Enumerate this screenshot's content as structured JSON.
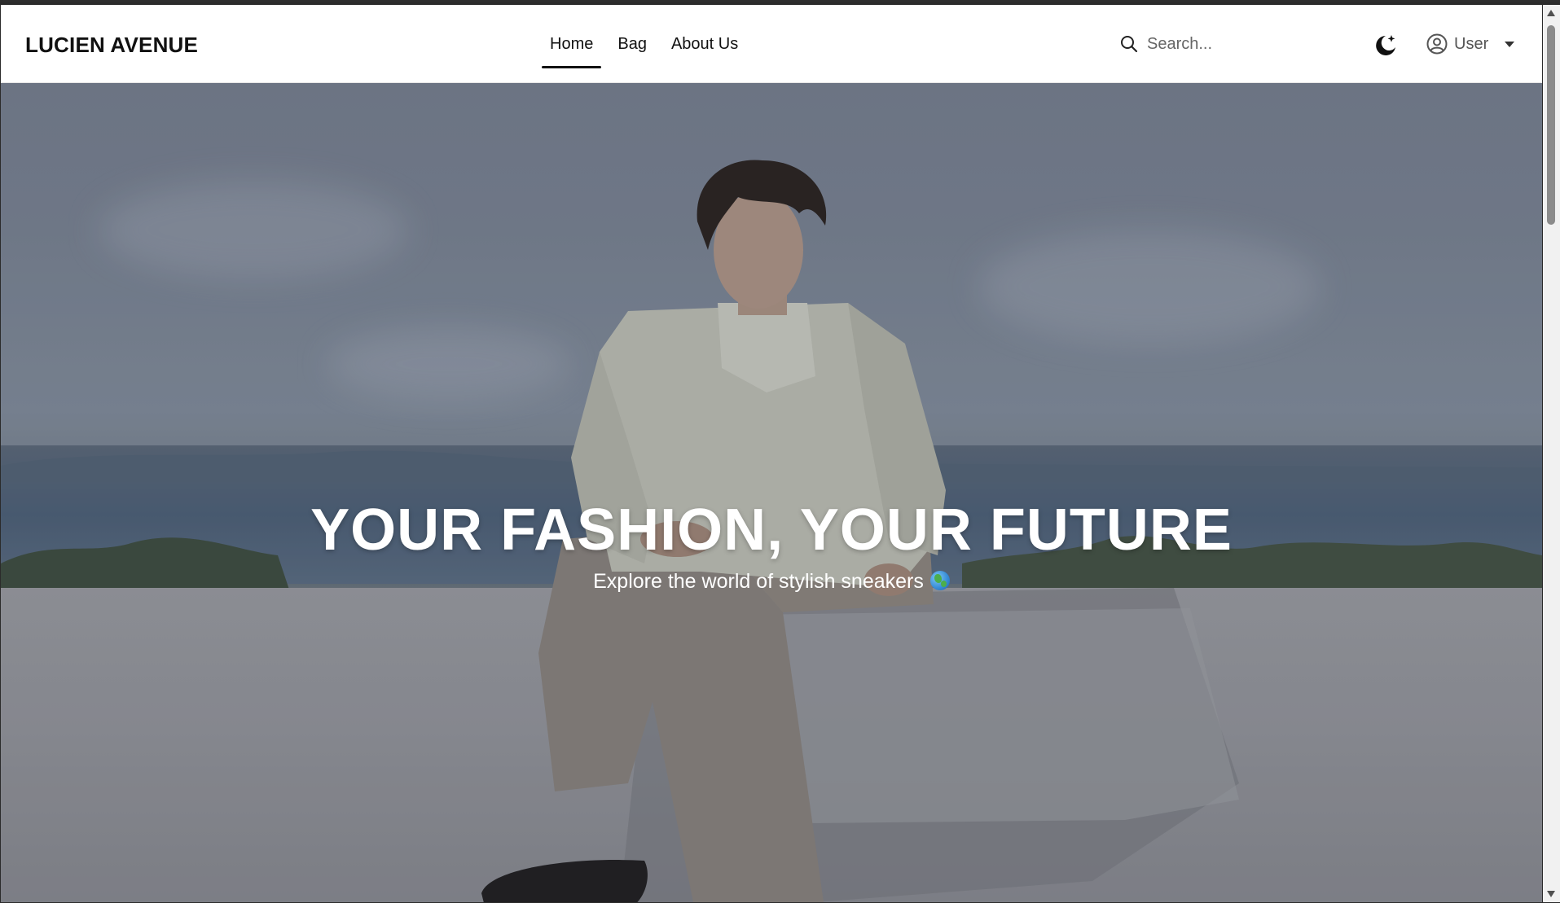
{
  "navbar": {
    "brand": "LUCIEN AVENUE",
    "links": [
      {
        "label": "Home",
        "active": true
      },
      {
        "label": "Bag",
        "active": false
      },
      {
        "label": "About Us",
        "active": false
      }
    ],
    "search": {
      "placeholder": "Search...",
      "value": "",
      "icon": "search-icon"
    },
    "theme_toggle": {
      "icon": "moon-sparkle-icon"
    },
    "user": {
      "label": "User",
      "icon": "user-circle-icon",
      "dropdown_icon": "caret-down-icon"
    }
  },
  "hero": {
    "title": "YOUR FASHION, YOUR FUTURE",
    "subtitle": "Explore the world of stylish sneakers",
    "subtitle_icon": "globe-icon"
  },
  "colors": {
    "nav_background": "#ffffff",
    "text_primary": "#111111",
    "hero_text": "#ffffff"
  }
}
